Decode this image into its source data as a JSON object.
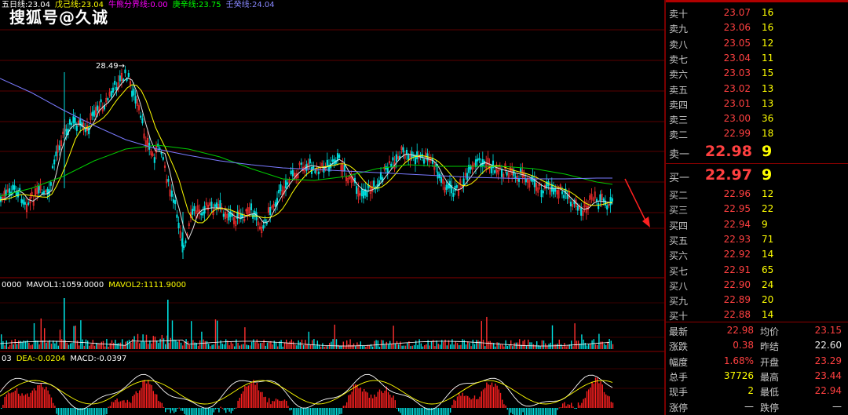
{
  "watermark": "搜狐号@久诚",
  "peak_label": "28.49→",
  "legend_main": [
    {
      "text": "五日线:23.04",
      "color": "#ffffff"
    },
    {
      "text": "戊己线:23.04",
      "color": "#ffff00"
    },
    {
      "text": "牛熊分界线:0.00",
      "color": "#ff00ff"
    },
    {
      "text": "庚辛线:23.75",
      "color": "#00ff00"
    },
    {
      "text": "壬癸线:24.04",
      "color": "#8888ff"
    }
  ],
  "legend_vol": [
    {
      "text": "0000",
      "color": "#ffffff"
    },
    {
      "text": "MAVOL1:1059.0000",
      "color": "#ffffff"
    },
    {
      "text": "MAVOL2:1111.9000",
      "color": "#ffff00"
    }
  ],
  "legend_macd": [
    {
      "text": "03",
      "color": "#ffffff"
    },
    {
      "text": "DEA:-0.0204",
      "color": "#ffff00"
    },
    {
      "text": "MACD:-0.0397",
      "color": "#ffffff"
    }
  ],
  "colors": {
    "accent": "#ff4040",
    "volume": "#ffff00",
    "grid": "#8a0000"
  },
  "order_book": {
    "asks": [
      {
        "label": "卖十",
        "price": "23.07",
        "vol": "16"
      },
      {
        "label": "卖九",
        "price": "23.06",
        "vol": "16"
      },
      {
        "label": "卖八",
        "price": "23.05",
        "vol": "12"
      },
      {
        "label": "卖七",
        "price": "23.04",
        "vol": "11"
      },
      {
        "label": "卖六",
        "price": "23.03",
        "vol": "15"
      },
      {
        "label": "卖五",
        "price": "23.02",
        "vol": "13"
      },
      {
        "label": "卖四",
        "price": "23.01",
        "vol": "13"
      },
      {
        "label": "卖三",
        "price": "23.00",
        "vol": "36"
      },
      {
        "label": "卖二",
        "price": "22.99",
        "vol": "18"
      },
      {
        "label": "卖一",
        "price": "22.98",
        "vol": "9"
      }
    ],
    "bids": [
      {
        "label": "买一",
        "price": "22.97",
        "vol": "9"
      },
      {
        "label": "买二",
        "price": "22.96",
        "vol": "12"
      },
      {
        "label": "买三",
        "price": "22.95",
        "vol": "22"
      },
      {
        "label": "买四",
        "price": "22.94",
        "vol": "9"
      },
      {
        "label": "买五",
        "price": "22.93",
        "vol": "71"
      },
      {
        "label": "买六",
        "price": "22.92",
        "vol": "14"
      },
      {
        "label": "买七",
        "price": "22.91",
        "vol": "65"
      },
      {
        "label": "买八",
        "price": "22.90",
        "vol": "24"
      },
      {
        "label": "买九",
        "price": "22.89",
        "vol": "20"
      },
      {
        "label": "买十",
        "price": "22.88",
        "vol": "14"
      }
    ]
  },
  "stats": [
    {
      "l1": "最新",
      "v1": "22.98",
      "c1": "red",
      "l2": "均价",
      "v2": "23.15",
      "c2": "red"
    },
    {
      "l1": "涨跌",
      "v1": "0.38",
      "c1": "red",
      "l2": "昨结",
      "v2": "22.60",
      "c2": "white"
    },
    {
      "l1": "幅度",
      "v1": "1.68%",
      "c1": "red",
      "l2": "开盘",
      "v2": "23.29",
      "c2": "red"
    },
    {
      "l1": "总手",
      "v1": "37726",
      "c1": "yel",
      "l2": "最高",
      "v2": "23.44",
      "c2": "red"
    },
    {
      "l1": "现手",
      "v1": "2",
      "c1": "yel",
      "l2": "最低",
      "v2": "22.94",
      "c2": "red"
    },
    {
      "l1": "涨停",
      "v1": "—",
      "c1": "white",
      "l2": "跌停",
      "v2": "—",
      "c2": "white"
    }
  ]
}
